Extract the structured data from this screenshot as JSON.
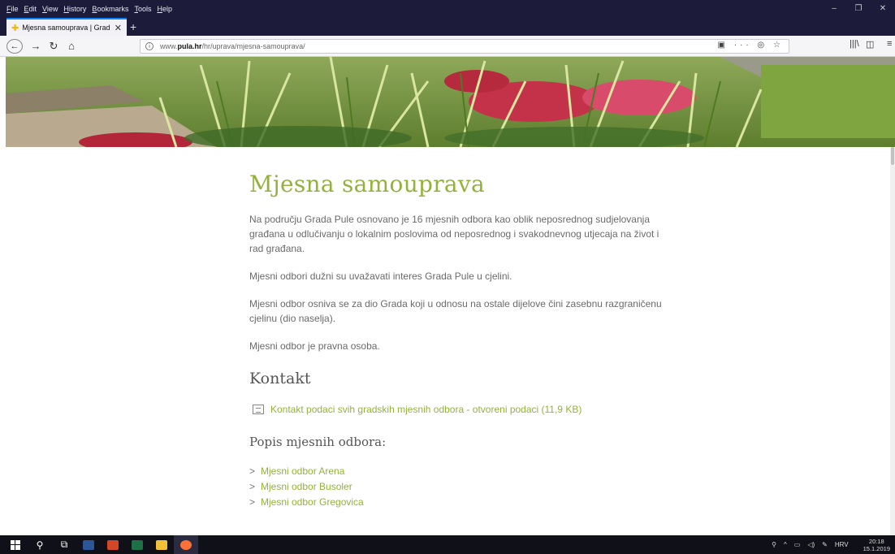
{
  "browser": {
    "menu": [
      "File",
      "Edit",
      "View",
      "History",
      "Bookmarks",
      "Tools",
      "Help"
    ],
    "tab_title": "Mjesna samouprava | Grad Pula",
    "url_prefix": "www.",
    "url_domain": "pula.hr",
    "url_path": "/hr/uprava/mjesna-samouprava/"
  },
  "page": {
    "title": "Mjesna samouprava",
    "paragraphs": [
      "Na području Grada Pule osnovano je 16 mjesnih odbora kao oblik neposrednog sudjelovanja građana u odlučivanju o lokalnim poslovima od neposrednog i svakodnevnog utjecaja na život i rad građana.",
      "Mjesni odbori dužni su uvažavati interes Grada Pule u cjelini.",
      "Mjesni odbor osniva se za dio Grada koji u odnosu na ostale dijelove čini zasebnu razgraničenu cjelinu (dio naselja).",
      "Mjesni odbor je pravna osoba."
    ],
    "contact_heading": "Kontakt",
    "contact_link": "Kontakt podaci svih gradskih mjesnih odbora - otvoreni podaci (11,9 KB)",
    "list_heading": "Popis mjesnih odbora:",
    "odbori": [
      "Mjesni odbor Arena",
      "Mjesni odbor Busoler",
      "Mjesni odbor Gregovica"
    ]
  },
  "taskbar": {
    "lang": "HRV",
    "time": "20:18",
    "date": "15.1.2019"
  },
  "colors": {
    "accent_green": "#93b23b",
    "browser_dark": "#1c1b3a"
  }
}
